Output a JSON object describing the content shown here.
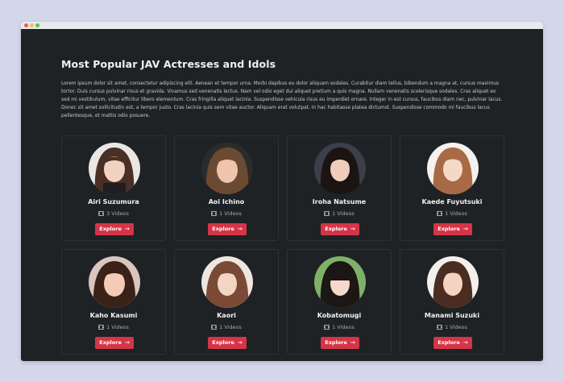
{
  "page": {
    "title": "Most Popular JAV Actresses and Idols",
    "intro": "Lorem ipsum dolor sit amet, consectetur adipiscing elit. Aenean et tempor urna. Morbi dapibus eu dolor aliquam sodales. Curabitur diam tellus, bibendum a magna at, cursus maximus tortor. Duis cursus pulvinar risus et gravida. Vivamus sed venenatis lectus. Nam vel odio eget dui aliquet pretium a quis magna. Nullam venenatis scelerisque sodales. Cras aliquet ex sed mi vestibulum, vitae efficitur libero elementum. Cras fringilla aliquet lacinia. Suspendisse vehicula risus eu imperdiet ornare. Integer in est cursus, faucibus diam nec, pulvinar lacus. Donec sit amet sollicitudin est, a tempor justo. Cras lacinia quis sem vitae auctor. Aliquam erat volutpat. In hac habitasse platea dictumst. Suspendisse commodo mi faucibus lacus pellentesque, et mattis odio posuere."
  },
  "colors": {
    "accent": "#d63447",
    "background": "#1f2225",
    "page_bg": "#d4d6ea"
  },
  "actresses": [
    {
      "name": "Airi Suzumura",
      "videos": "3 Videos",
      "button": "Explore"
    },
    {
      "name": "Aoi Ichino",
      "videos": "1 Videos",
      "button": "Explore"
    },
    {
      "name": "Iroha Natsume",
      "videos": "1 Videos",
      "button": "Explore"
    },
    {
      "name": "Kaede Fuyutsuki",
      "videos": "1 Videos",
      "button": "Explore"
    },
    {
      "name": "Kaho Kasumi",
      "videos": "1 Videos",
      "button": "Explore"
    },
    {
      "name": "Kaori",
      "videos": "1 Videos",
      "button": "Explore"
    },
    {
      "name": "Kobatomugi",
      "videos": "1 Videos",
      "button": "Explore"
    },
    {
      "name": "Manami Suzuki",
      "videos": "1 Videos",
      "button": "Explore"
    }
  ]
}
